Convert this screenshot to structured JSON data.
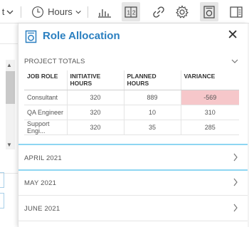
{
  "toolbar": {
    "partial_dropdown_text": "t",
    "time_unit": "Hours",
    "icons": [
      "clock-icon",
      "bar-chart-icon",
      "compare-icon",
      "link-icon",
      "gear-icon",
      "role-allocation-icon",
      "panel-toggle-icon"
    ]
  },
  "panel": {
    "title": "Role Allocation",
    "close_label": "✕",
    "project_totals": {
      "label": "PROJECT TOTALS",
      "columns": [
        "JOB ROLE",
        "INITIATIVE HOURS",
        "PLANNED HOURS",
        "VARIANCE"
      ],
      "rows": [
        {
          "role": "Consultant",
          "initiative": "320",
          "planned": "889",
          "variance": "-569"
        },
        {
          "role": "QA Engineer",
          "initiative": "320",
          "planned": "10",
          "variance": "310"
        },
        {
          "role": "Support Engi...",
          "initiative": "320",
          "planned": "35",
          "variance": "285"
        }
      ]
    },
    "months": [
      "APRIL 2021",
      "MAY 2021",
      "JUNE 2021"
    ]
  },
  "colors": {
    "accent": "#2a7fc0",
    "negative_bg": "#f6c7ca",
    "negative_border": "#d03c44",
    "divider_blue": "#8ed6f2"
  }
}
